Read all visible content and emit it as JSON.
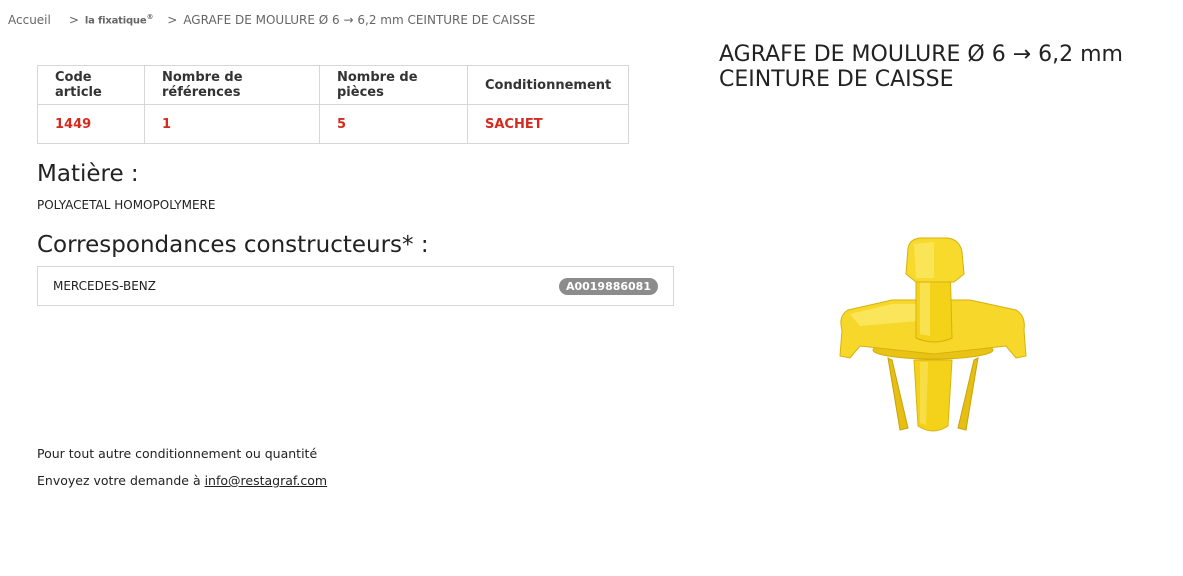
{
  "breadcrumb": {
    "home": "Accueil",
    "sep1": ">",
    "brand": "la fixatique",
    "brand_mark": "®",
    "sep2": ">",
    "current": "AGRAFE DE MOULURE Ø 6 → 6,2 mm CEINTURE DE CAISSE"
  },
  "specs": {
    "headers": [
      "Code article",
      "Nombre de références",
      "Nombre de pièces",
      "Conditionnement"
    ],
    "values": [
      "1449",
      "1",
      "5",
      "SACHET"
    ]
  },
  "material": {
    "title": "Matière :",
    "value": "POLYACETAL HOMOPOLYMERE"
  },
  "correspondences": {
    "title": "Correspondances constructeurs* :",
    "items": [
      {
        "maker": "MERCEDES-BENZ",
        "ref": "A0019886081"
      }
    ]
  },
  "contact": {
    "line1": "Pour tout autre conditionnement ou quantité",
    "line2_prefix": "Envoyez votre demande à ",
    "email": "info@restagraf.com"
  },
  "product": {
    "title_line1": "AGRAFE DE MOULURE Ø 6 → 6,2 mm",
    "title_line2": "CEINTURE DE CAISSE",
    "image_icon": "yellow-plastic-clip",
    "color": "#f5d21a"
  },
  "colors": {
    "accent_red": "#d42b1e",
    "badge_grey": "#8c8c8c"
  }
}
